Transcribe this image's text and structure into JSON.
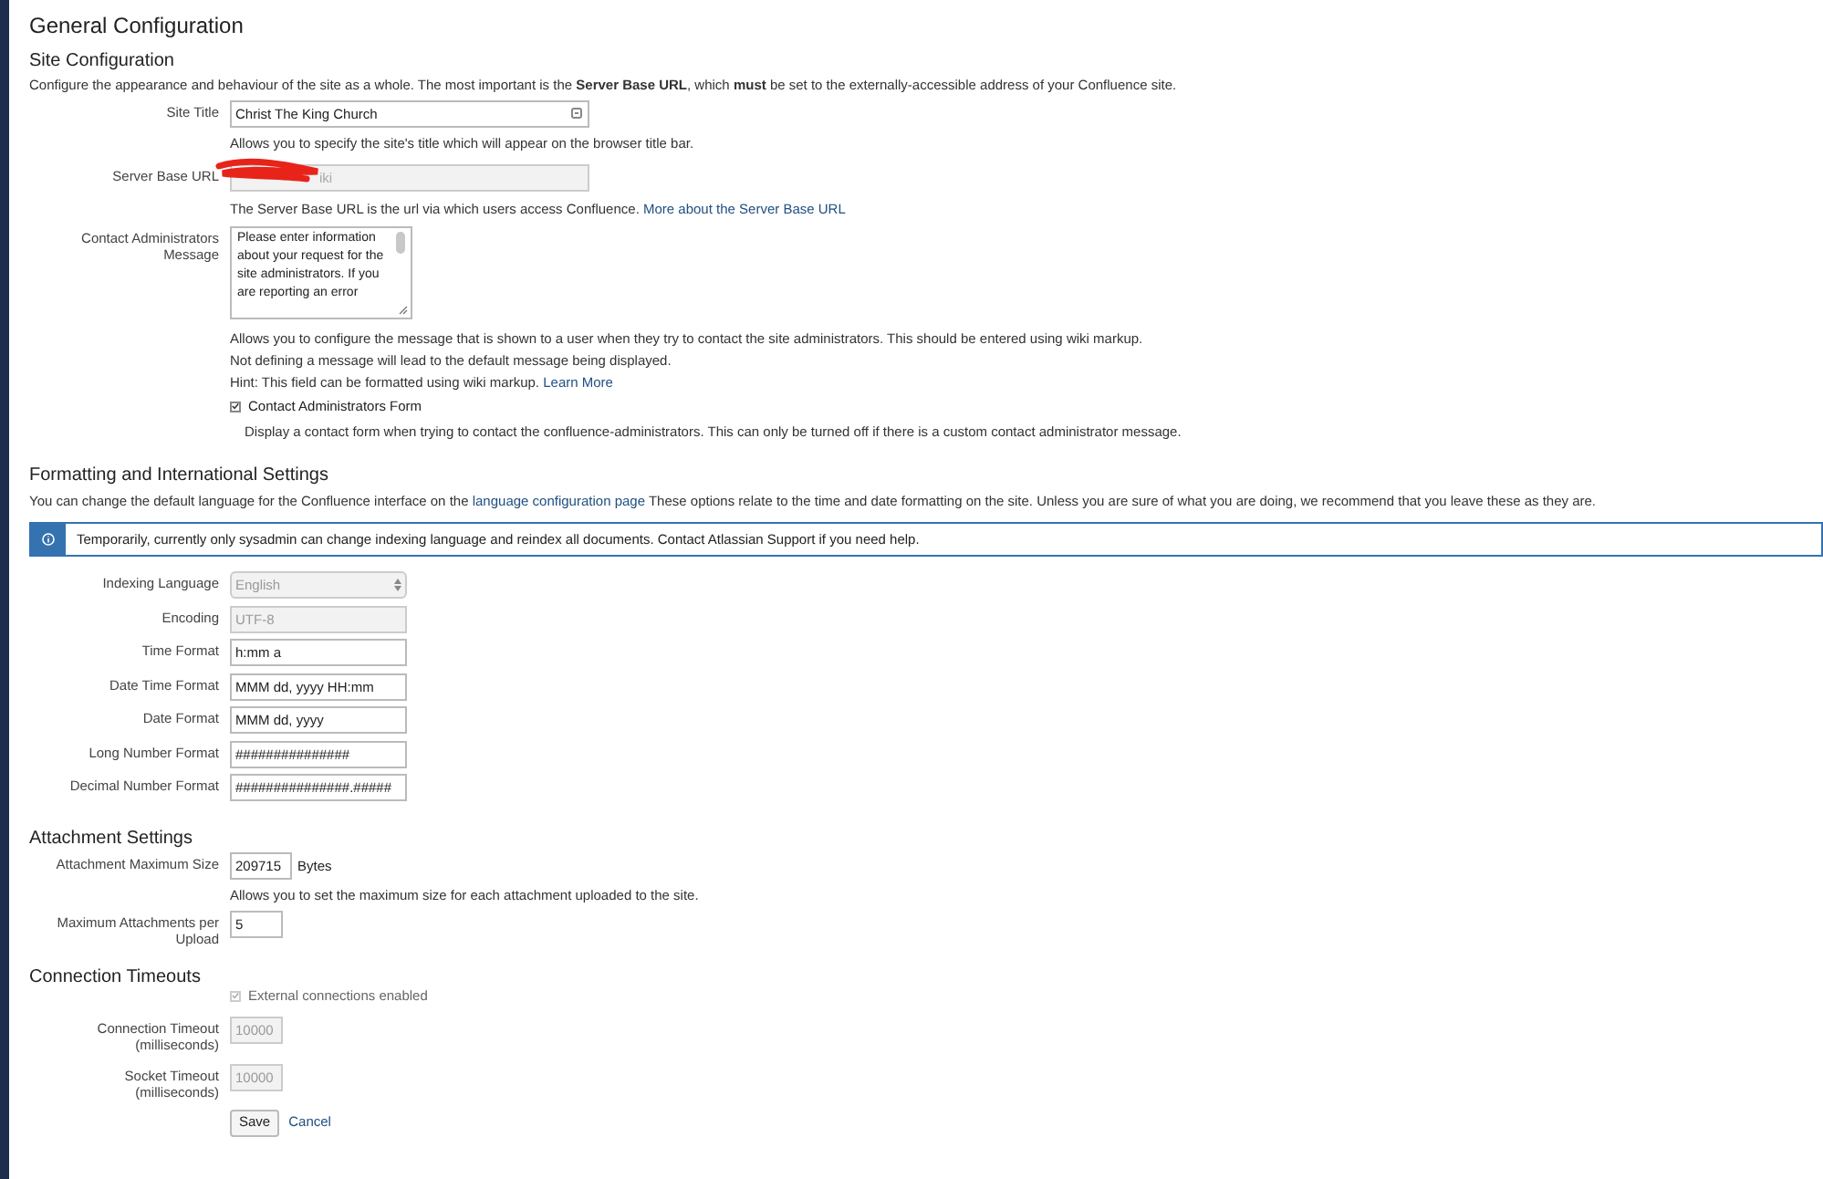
{
  "page_title": "General Configuration",
  "site_configuration": {
    "heading": "Site Configuration",
    "description": "Configure the appearance and behaviour of the site as a whole. The most important is the **Server Base URL**, which **must** be set to the externally-accessible address of your Confluence site.",
    "site_title": {
      "label": "Site Title",
      "value": "Christ The King Church",
      "help": "Allows you to specify the site's title which will appear on the browser title bar."
    },
    "server_base_url": {
      "label": "Server Base URL",
      "value": "iki",
      "disabled": true,
      "help": "The Server Base URL is the url via which users access Confluence.",
      "help_link": "More about the Server Base URL"
    },
    "contact_message": {
      "label_lines": [
        "Contact Administrators",
        "Message"
      ],
      "value": "Please enter information about your request for the site administrators. If you are reporting an error",
      "help_lines": [
        "Allows you to configure the message that is shown to a user when they try to contact the site administrators. This should be entered using wiki markup.",
        "Not defining a message will lead to the default message being displayed."
      ],
      "hint": "Hint: This field can be formatted using wiki markup.",
      "hint_link": "Learn More"
    },
    "contact_form": {
      "label": "Contact Administrators Form",
      "checked": true,
      "disabled": false,
      "description": "Display a contact form when trying to contact the confluence-administrators. This can only be turned off if there is a custom contact administrator message."
    }
  },
  "formatting": {
    "heading": "Formatting and International Settings",
    "description_before": "You can change the default language for the Confluence interface on the",
    "description_link": "language configuration page",
    "description_after": "These options relate to the time and date formatting on the site. Unless you are sure of what you are doing, we recommend that you leave these as they are.",
    "info": "Temporarily, currently only sysadmin can change indexing language and reindex all documents. Contact Atlassian Support if you need help.",
    "fields": [
      {
        "label": "Indexing Language",
        "value": "English",
        "kind": "select",
        "disabled": true
      },
      {
        "label": "Encoding",
        "value": "UTF-8",
        "kind": "text",
        "disabled": true
      },
      {
        "label": "Time Format",
        "value": "h:mm a",
        "kind": "text",
        "disabled": false
      },
      {
        "label": "Date Time Format",
        "value": "MMM dd, yyyy HH:mm",
        "kind": "text",
        "disabled": false
      },
      {
        "label": "Date Format",
        "value": "MMM dd, yyyy",
        "kind": "text",
        "disabled": false
      },
      {
        "label": "Long Number Format",
        "value": "###############",
        "kind": "text",
        "disabled": false
      },
      {
        "label": "Decimal Number Format",
        "value": "###############.#####",
        "kind": "text",
        "disabled": false
      }
    ]
  },
  "attachments": {
    "heading": "Attachment Settings",
    "max_size": {
      "label": "Attachment Maximum Size",
      "value": "209715",
      "unit": "Bytes",
      "help": "Allows you to set the maximum size for each attachment uploaded to the site."
    },
    "max_per_upload": {
      "label_lines": [
        "Maximum Attachments per",
        "Upload"
      ],
      "value": "5"
    }
  },
  "connection": {
    "heading": "Connection Timeouts",
    "external": {
      "label": "External connections enabled",
      "checked": true,
      "disabled": true
    },
    "fields": [
      {
        "label_lines": [
          "Connection Timeout",
          "(milliseconds)"
        ],
        "value": "10000",
        "disabled": true
      },
      {
        "label_lines": [
          "Socket Timeout",
          "(milliseconds)"
        ],
        "value": "10000",
        "disabled": true
      }
    ]
  },
  "actions": {
    "save": "Save",
    "cancel": "Cancel"
  }
}
